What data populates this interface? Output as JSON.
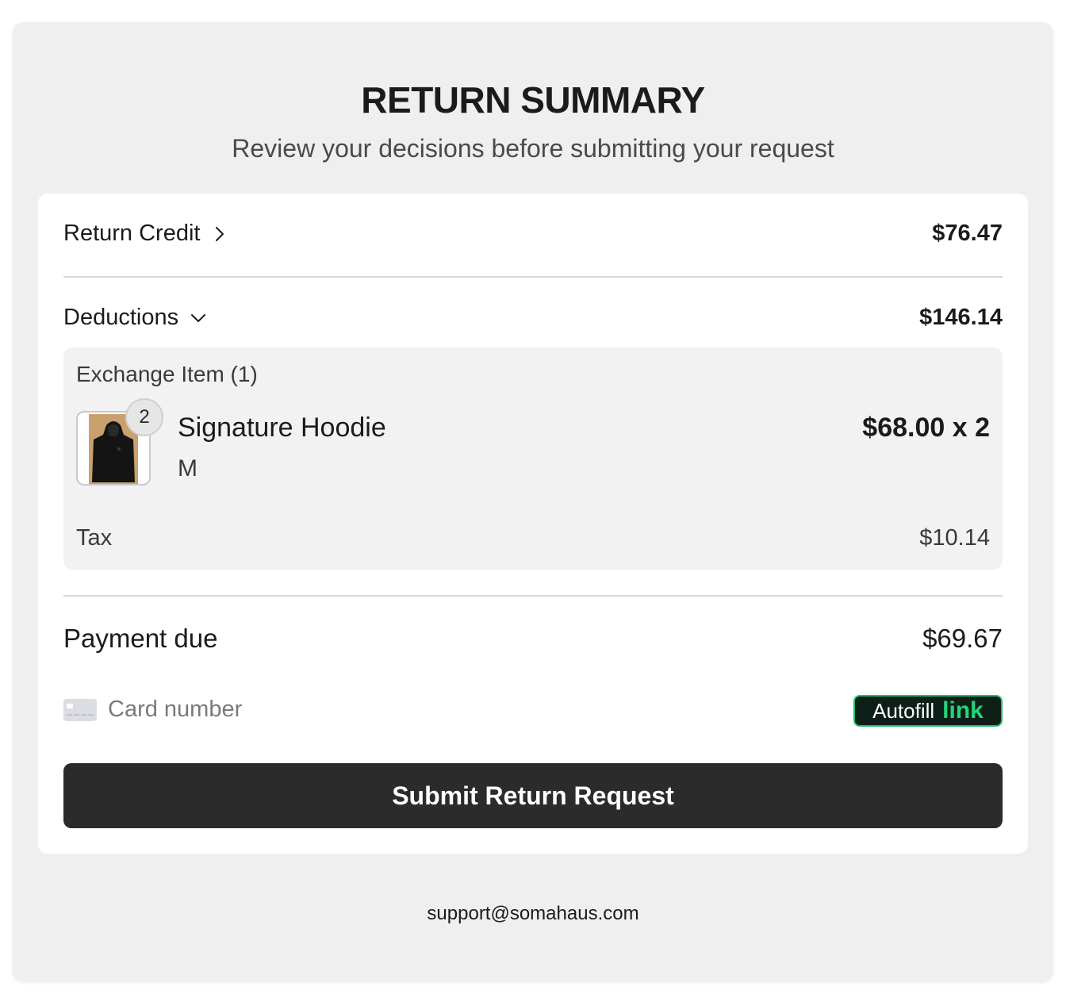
{
  "header": {
    "title": "RETURN SUMMARY",
    "subtitle": "Review your decisions before submitting your request"
  },
  "summary": {
    "return_credit": {
      "label": "Return Credit",
      "value": "$76.47",
      "icon": "chevron-right-icon"
    },
    "deductions": {
      "label": "Deductions",
      "value": "$146.14",
      "icon": "chevron-down-icon",
      "exchange_label": "Exchange Item (1)",
      "item": {
        "name": "Signature Hoodie",
        "variant": "M",
        "quantity": "2",
        "price": "$68.00 x 2"
      },
      "tax": {
        "label": "Tax",
        "value": "$10.14"
      }
    },
    "payment_due": {
      "label": "Payment due",
      "value": "$69.67"
    }
  },
  "payment": {
    "card_placeholder": "Card number",
    "autofill_label": "Autofill",
    "autofill_brand": "link"
  },
  "actions": {
    "submit_label": "Submit Return Request"
  },
  "footer": {
    "support_email": "support@somahaus.com"
  },
  "colors": {
    "page_bg": "#efefef",
    "card_bg": "#ffffff",
    "button_bg": "#2b2b2b",
    "link_green": "#25d47a",
    "link_bg": "#0d1f17"
  }
}
